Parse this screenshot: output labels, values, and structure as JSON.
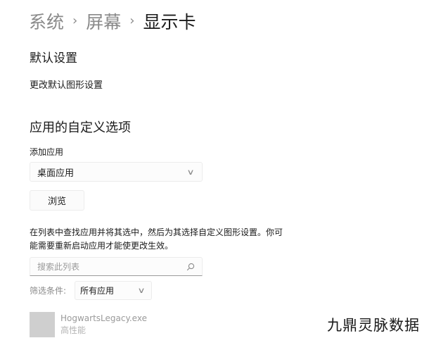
{
  "breadcrumb": {
    "items": [
      "系统",
      "屏幕",
      "显示卡"
    ],
    "separator": "›"
  },
  "default_settings": {
    "title": "默认设置",
    "link": "更改默认图形设置"
  },
  "custom_options": {
    "title": "应用的自定义选项",
    "add_app_label": "添加应用",
    "app_type_selected": "桌面应用",
    "browse_label": "浏览",
    "description_line1": "在列表中查找应用并将其选中，然后为其选择自定义图形设置。你可",
    "description_line2": "能需要重新启动应用才能使更改生效。",
    "search_placeholder": "搜索此列表",
    "filter_label": "筛选条件:",
    "filter_selected": "所有应用"
  },
  "apps": [
    {
      "name": "HogwartsLegacy.exe",
      "setting": "高性能"
    }
  ],
  "watermark": "九鼎灵脉数据",
  "colors": {
    "text_primary": "#1a1a1a",
    "text_secondary": "#8a8a8a",
    "control_border": "#ececec",
    "app_icon_placeholder": "#cfcfcf"
  },
  "icons": {
    "breadcrumb_separator": "chevron-right-icon",
    "dropdown": "chevron-down-icon",
    "search": "search-icon"
  }
}
